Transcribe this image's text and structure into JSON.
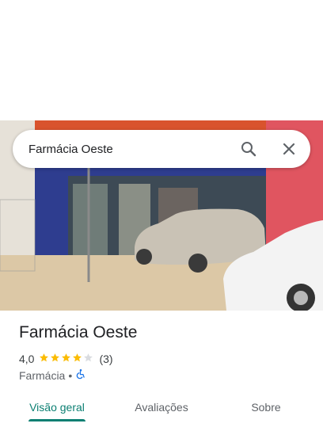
{
  "search": {
    "value": "Farmácia Oeste",
    "search_icon": "search-icon",
    "close_icon": "close-icon"
  },
  "place": {
    "name": "Farmácia Oeste",
    "rating": "4,0",
    "stars": 4,
    "review_count": "(3)",
    "category": "Farmácia",
    "separator": "•",
    "accessibility_icon": "wheelchair-accessible-icon"
  },
  "tabs": [
    {
      "label": "Visão geral",
      "active": true
    },
    {
      "label": "Avaliações",
      "active": false
    },
    {
      "label": "Sobre",
      "active": false
    }
  ],
  "colors": {
    "accent": "#0b7f72",
    "star": "#fbbc04",
    "star_empty": "#dadce0",
    "accessibility": "#1a73e8"
  }
}
